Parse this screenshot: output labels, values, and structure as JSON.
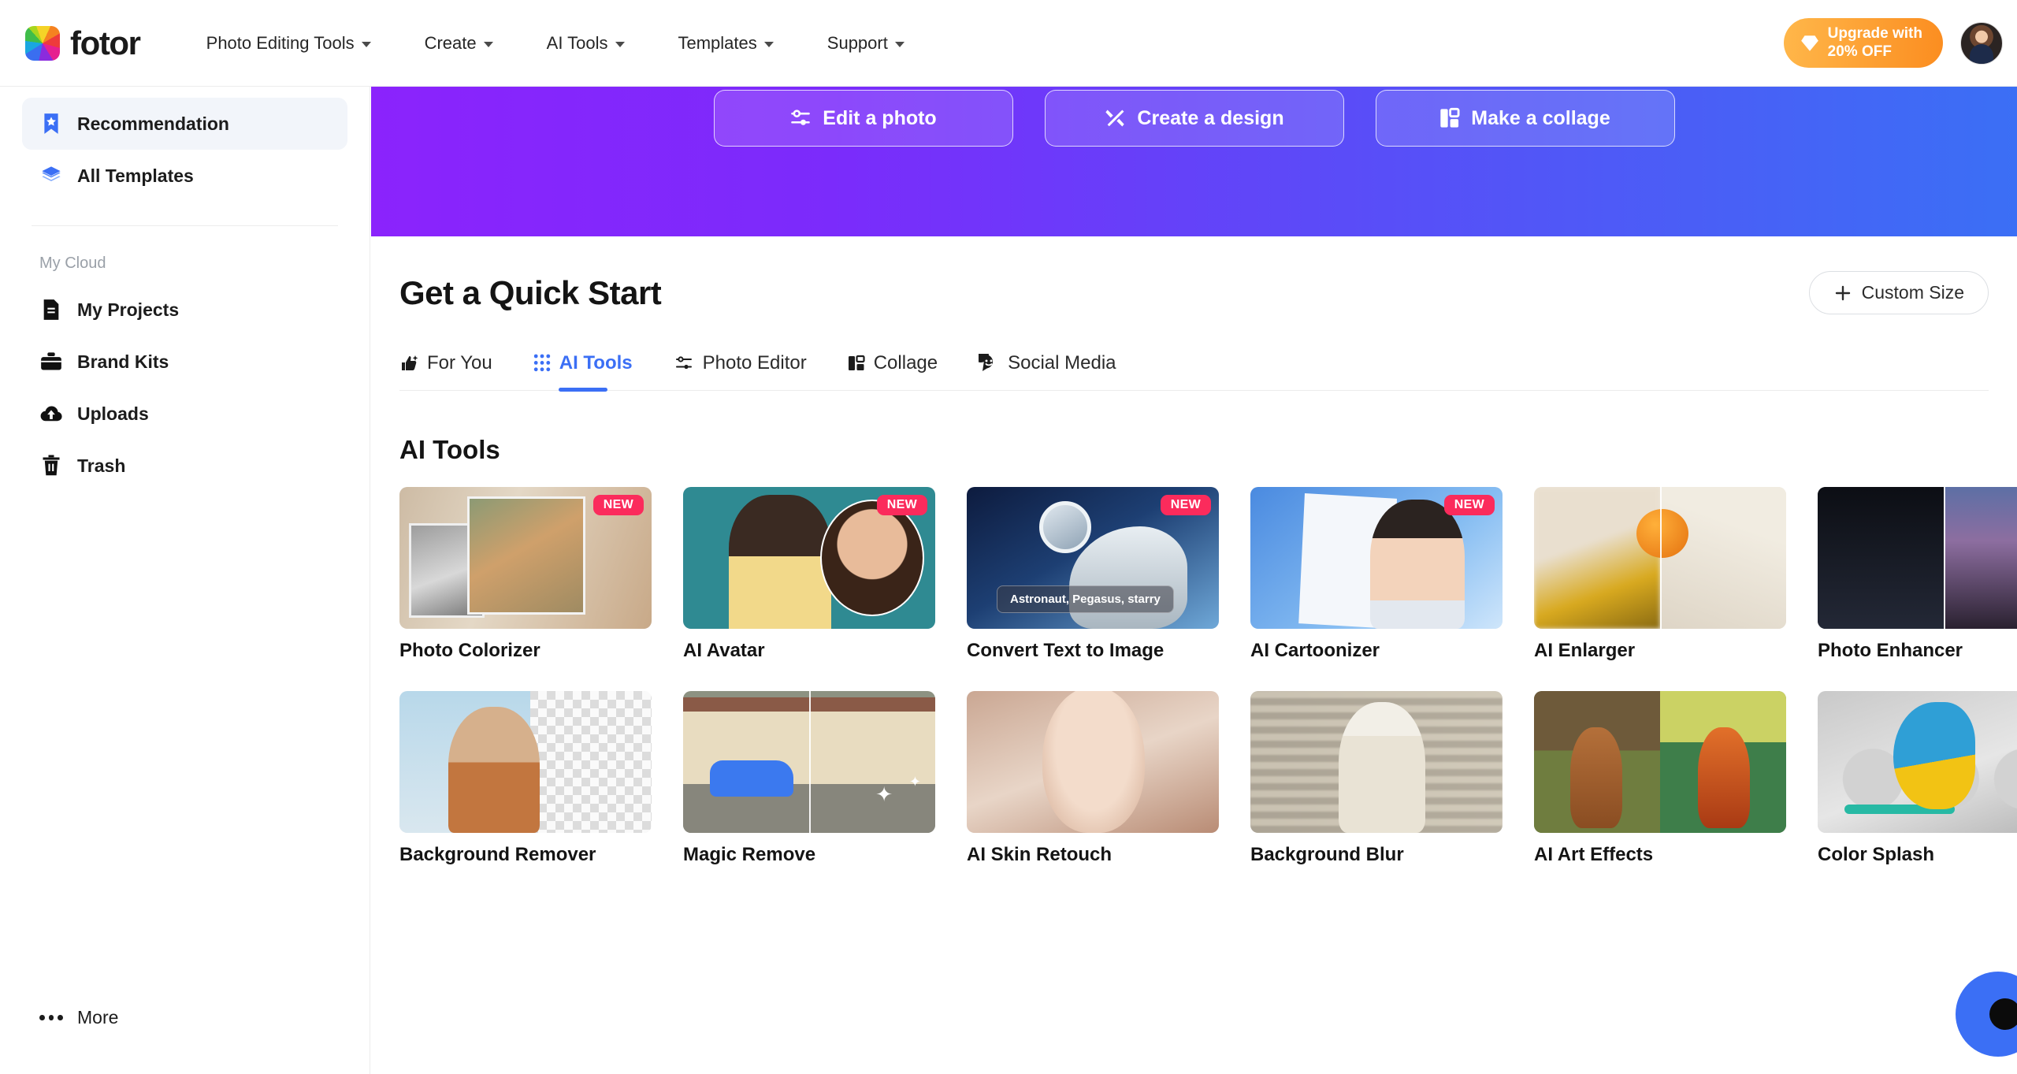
{
  "header": {
    "logo_text": "fotor",
    "nav": [
      {
        "label": "Photo Editing Tools",
        "has_caret": true
      },
      {
        "label": "Create",
        "has_caret": true
      },
      {
        "label": "AI Tools",
        "has_caret": true
      },
      {
        "label": "Templates",
        "has_caret": true
      },
      {
        "label": "Support",
        "has_caret": true
      }
    ],
    "upgrade": {
      "line1": "Upgrade with",
      "line2": "20% OFF",
      "icon": "diamond-icon"
    },
    "avatar_alt": "user-avatar"
  },
  "sidebar": {
    "primary": [
      {
        "label": "Recommendation",
        "icon": "bookmark-star-icon",
        "active": true
      },
      {
        "label": "All Templates",
        "icon": "layers-icon",
        "active": false
      }
    ],
    "section_label": "My Cloud",
    "cloud": [
      {
        "label": "My Projects",
        "icon": "document-icon"
      },
      {
        "label": "Brand Kits",
        "icon": "briefcase-icon"
      },
      {
        "label": "Uploads",
        "icon": "cloud-upload-icon"
      },
      {
        "label": "Trash",
        "icon": "trash-icon"
      }
    ],
    "more": {
      "label": "More",
      "icon": "ellipsis-icon"
    }
  },
  "banner": {
    "buttons": [
      {
        "label": "Edit a photo",
        "icon": "sliders-icon"
      },
      {
        "label": "Create a design",
        "icon": "pen-ruler-icon"
      },
      {
        "label": "Make a collage",
        "icon": "collage-grid-icon"
      }
    ],
    "gradient_from": "#8b23fc",
    "gradient_to": "#3b6ff5"
  },
  "quick_start": {
    "title": "Get a Quick Start",
    "custom_size": {
      "label": "Custom Size",
      "icon": "plus-icon"
    },
    "tabs": [
      {
        "label": "For You",
        "icon": "thumbs-up-icon",
        "active": false
      },
      {
        "label": "AI Tools",
        "icon": "dots-grid-icon",
        "active": true
      },
      {
        "label": "Photo Editor",
        "icon": "sliders-icon",
        "active": false
      },
      {
        "label": "Collage",
        "icon": "collage-grid-icon",
        "active": false
      },
      {
        "label": "Social Media",
        "icon": "chat-smile-icon",
        "active": false
      }
    ],
    "accent_color": "#3b6ff5"
  },
  "ai_tools": {
    "section_title": "AI Tools",
    "badge_text": "NEW",
    "badge_color": "#fb2b5c",
    "cards": [
      {
        "label": "Photo Colorizer",
        "badge": "NEW",
        "art": "t-coloriz"
      },
      {
        "label": "AI Avatar",
        "badge": "NEW",
        "art": "t-avatar"
      },
      {
        "label": "Convert Text to Image",
        "badge": "NEW",
        "art": "t-text2img",
        "prompt": "Astronaut, Pegasus, starry"
      },
      {
        "label": "AI Cartoonizer",
        "badge": "NEW",
        "art": "t-cartoon"
      },
      {
        "label": "AI Enlarger",
        "badge": "",
        "art": "t-enlarge"
      },
      {
        "label": "Photo Enhancer",
        "badge": "",
        "art": "t-enhance"
      },
      {
        "label": "Background Remover",
        "badge": "",
        "art": "t-bgrem"
      },
      {
        "label": "Magic Remove",
        "badge": "",
        "art": "t-magic"
      },
      {
        "label": "AI Skin Retouch",
        "badge": "",
        "art": "t-skin"
      },
      {
        "label": "Background Blur",
        "badge": "",
        "art": "t-blur"
      },
      {
        "label": "AI Art Effects",
        "badge": "",
        "art": "t-art"
      },
      {
        "label": "Color Splash",
        "badge": "",
        "art": "t-splash"
      }
    ]
  },
  "fab": {
    "name": "help-chat-button",
    "color": "#3b6ff5"
  }
}
